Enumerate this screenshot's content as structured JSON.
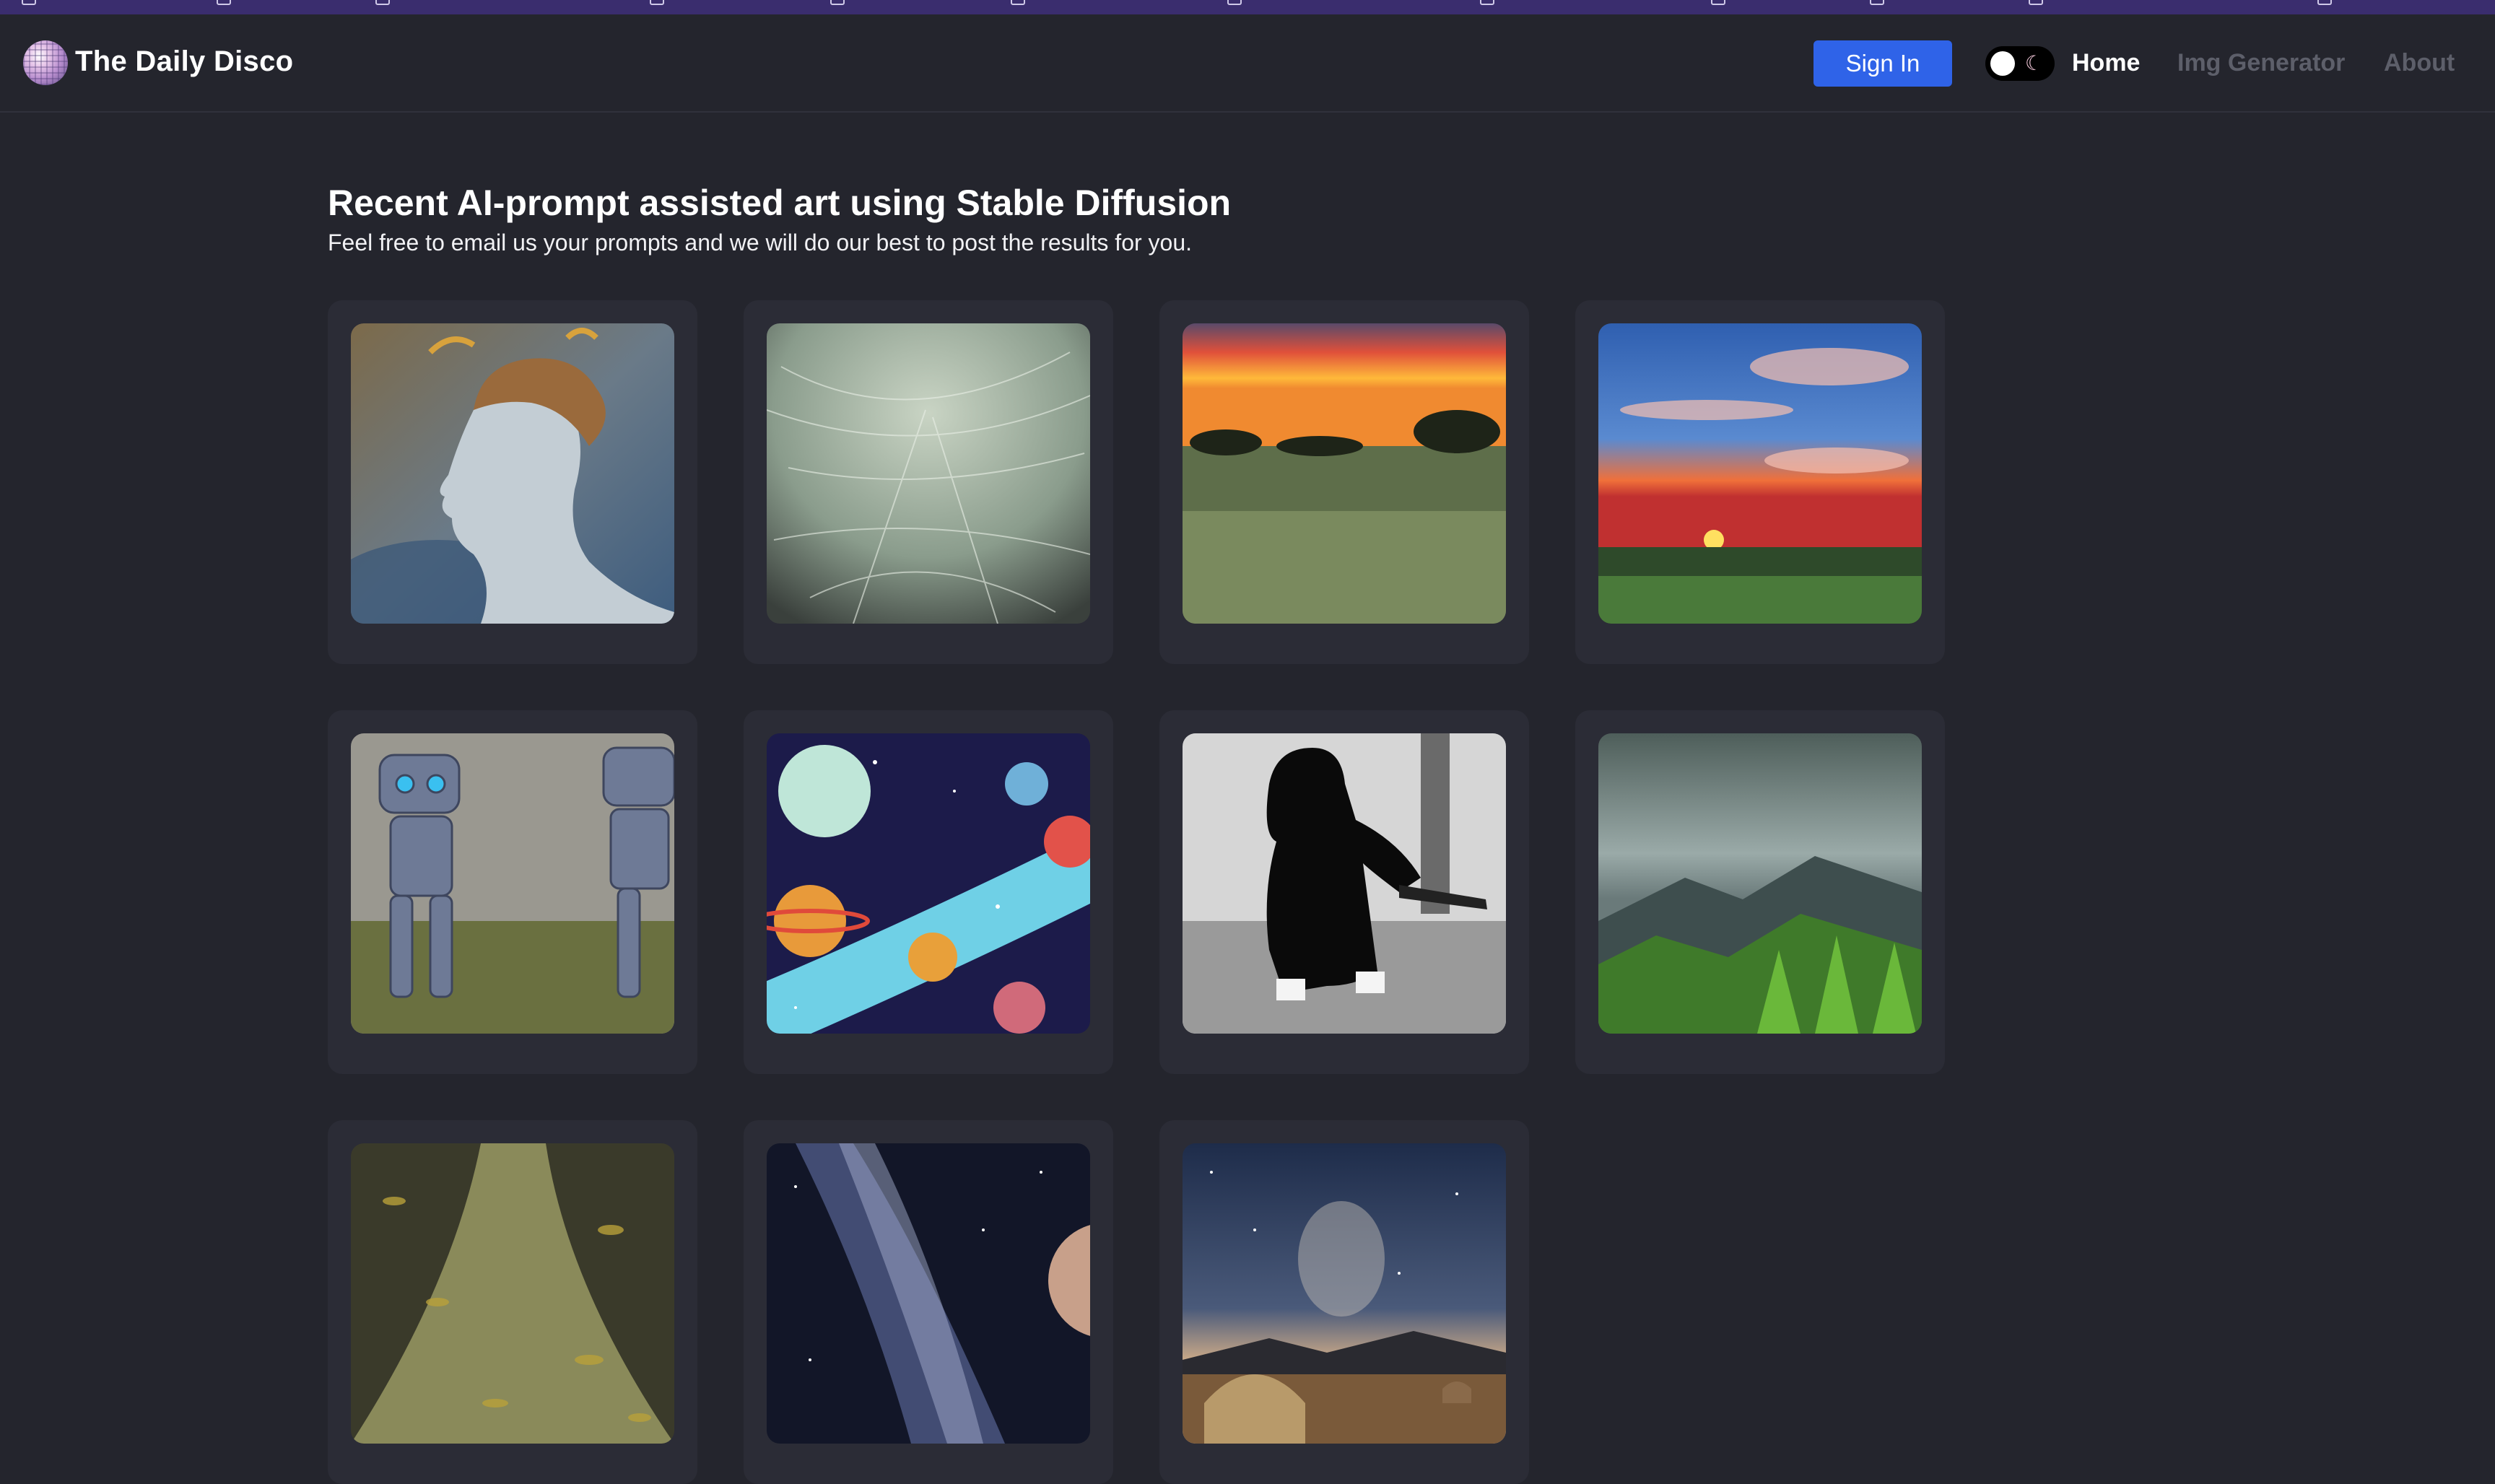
{
  "navbar": {
    "site_title": "The Daily Disco",
    "logo_icon": "disco-ball-icon",
    "sign_in_label": "Sign In",
    "theme_toggle_icons": [
      "sun-icon",
      "moon-icon"
    ],
    "links": [
      "Home",
      "Img Generator",
      "About"
    ],
    "active_link": "Home"
  },
  "main": {
    "title": "Recent AI-prompt assisted art using Stable Diffusion",
    "subtitle": "Feel free to email us your prompts and we will do our best to post the results for you."
  },
  "gallery": {
    "images": [
      "watercolor-portrait-image",
      "textured-abstract-image",
      "savanna-sunset-image",
      "dramatic-sky-sunset-image",
      "robots-image",
      "space-planets-image",
      "darth-vader-baseball-image",
      "misty-mountain-forest-image",
      "leaf-stream-image",
      "milky-way-planet-image",
      "night-sky-dome-image"
    ]
  },
  "colors": {
    "background": "#24252d",
    "card": "#2b2c36",
    "accent": "#2f63e8",
    "bookmark_bar": "#3a2d6e"
  }
}
